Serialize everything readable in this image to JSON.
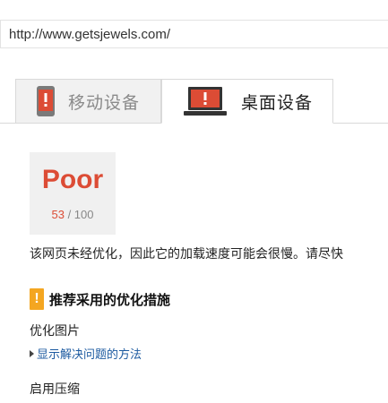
{
  "address_bar": {
    "url": "http://www.getsjewels.com/"
  },
  "tabs": [
    {
      "label": "移动设备",
      "icon": "mobile-warning-icon",
      "active": false
    },
    {
      "label": "桌面设备",
      "icon": "laptop-warning-icon",
      "active": true
    }
  ],
  "score": {
    "label": "Poor",
    "value": "53",
    "separator": " / ",
    "max": "100",
    "color": "#dc4c35"
  },
  "summary": "该网页未经优化，因此它的加载速度可能会很慢。请尽快",
  "section": {
    "badge": "!",
    "title": "推荐采用的优化措施",
    "badge_color": "#f4a621"
  },
  "rules": [
    {
      "title": "优化图片",
      "link": "显示解决问题的方法"
    },
    {
      "title": "启用压缩"
    }
  ]
}
